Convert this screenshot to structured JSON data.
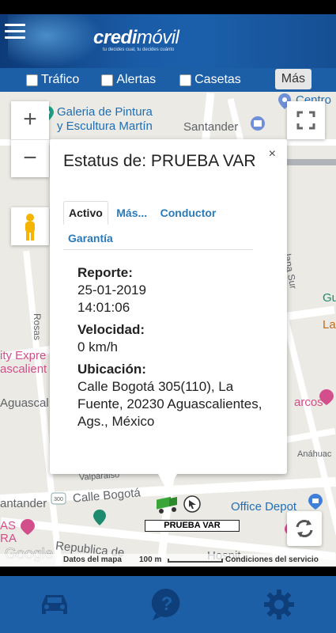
{
  "header": {
    "brand_prefix": "credi",
    "brand_suffix": "móvil",
    "tagline": "tu decides cual, tu decides cuánto"
  },
  "toolbar": {
    "trafico": "Tráfico",
    "alertas": "Alertas",
    "casetas": "Casetas",
    "mas": "Más"
  },
  "map": {
    "labels": [
      "Galeria de Pintura",
      "y Escultura Martín",
      "Santander",
      "Centro",
      "Rosas",
      "ity Expre",
      "ascalient",
      "Aguascal",
      "arcos",
      "Anáhuac",
      "Valparaiso",
      "Calle Bogotá",
      "antander",
      "Office Depot",
      "Republica de",
      "Hospit",
      "lana Sur",
      "AS",
      "RA",
      "La",
      "Gu"
    ],
    "attribution": {
      "datos": "Datos del mapa",
      "scale": "100 m",
      "terms": "Condiciones del servicio"
    }
  },
  "popup": {
    "title": "Estatus de: PRUEBA VAR",
    "close": "×",
    "tabs": [
      "Activo",
      "Más...",
      "Conductor",
      "Garantía"
    ],
    "reporte_label": "Reporte:",
    "reporte_value": "25-01-2019 14:01:06",
    "velocidad_label": "Velocidad:",
    "velocidad_value": "0 km/h",
    "ubicacion_label": "Ubicación:",
    "ubicacion_value": "Calle Bogotá 305(110), La Fuente, 20230 Aguascalientes, Ags., México"
  },
  "vehicle": {
    "label": "PRUEBA VAR"
  },
  "colors": {
    "brand_blue": "#1c5fa7",
    "link_blue": "#2a7ab8",
    "progress_green": "#3ec14a"
  }
}
